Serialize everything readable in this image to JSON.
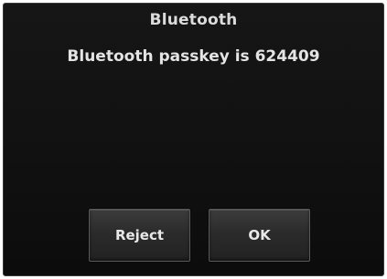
{
  "dialog": {
    "title": "Bluetooth",
    "message": "Bluetooth passkey is 624409"
  },
  "buttons": {
    "reject_label": "Reject",
    "ok_label": "OK"
  },
  "colors": {
    "background": "#111111",
    "button_face": "#2e2e2e",
    "text": "#e6e6e6"
  }
}
